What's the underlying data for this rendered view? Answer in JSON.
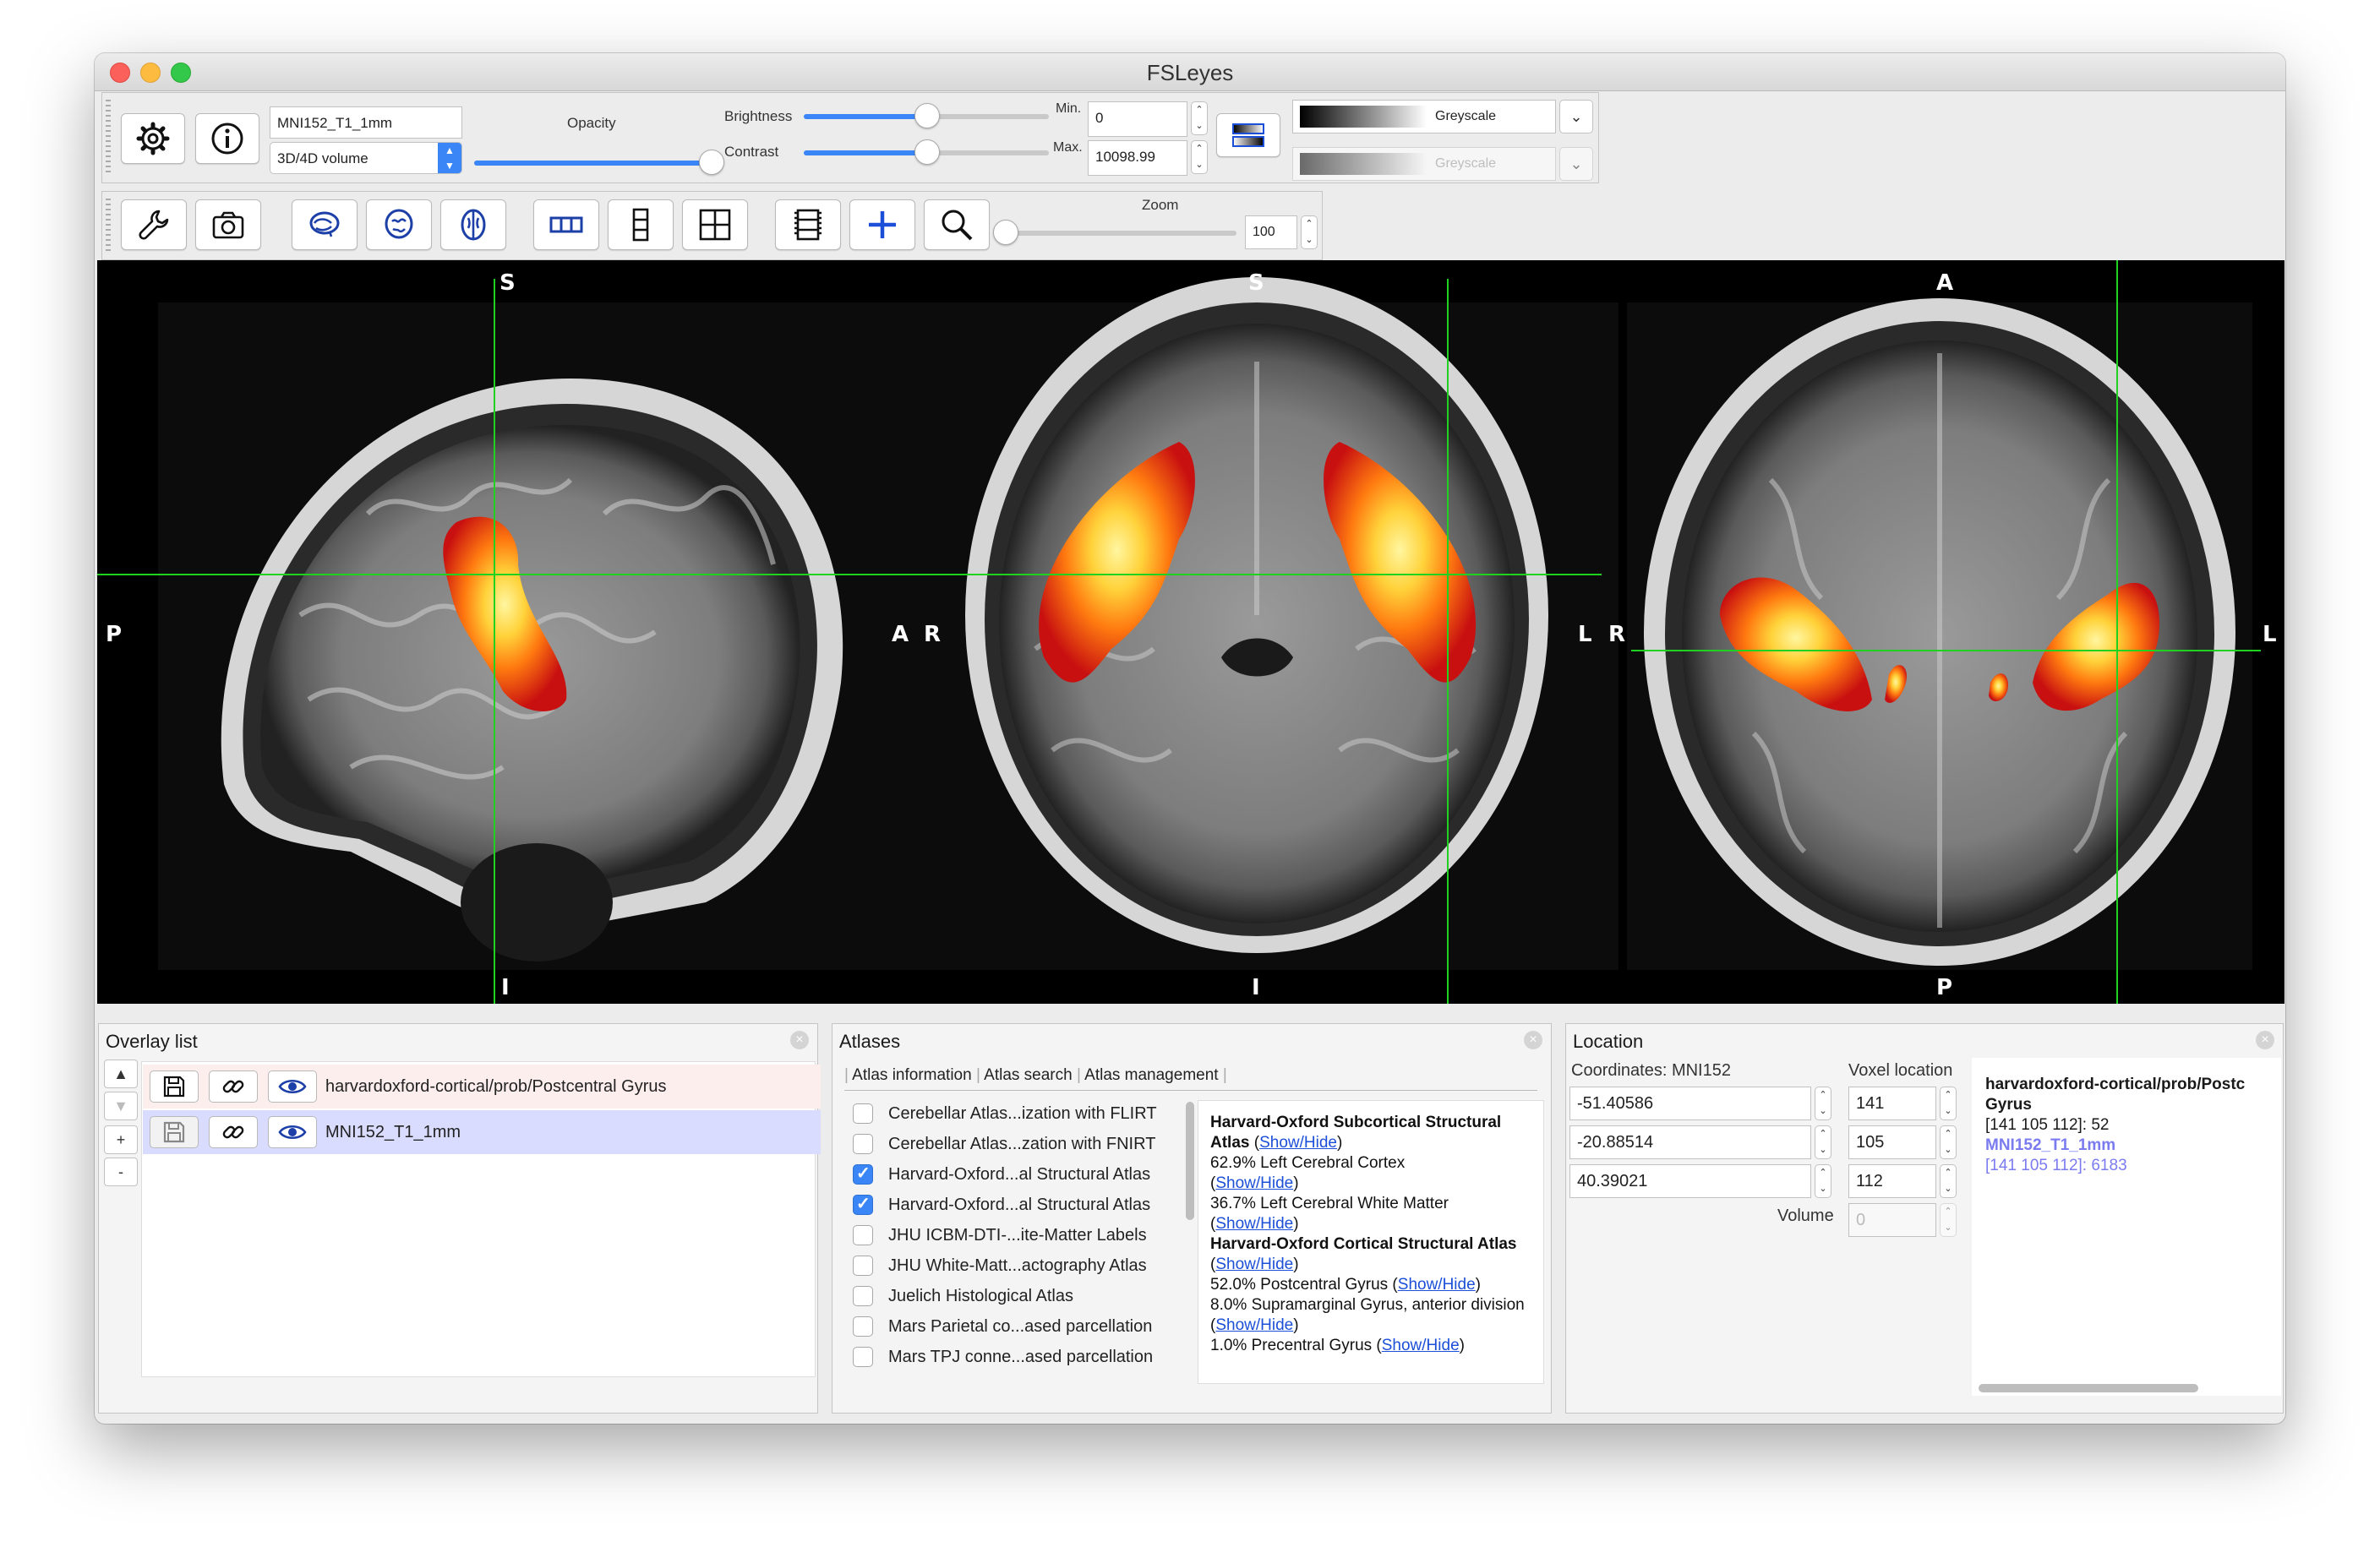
{
  "window": {
    "title": "FSLeyes"
  },
  "toolbar": {
    "image_name": "MNI152_T1_1mm",
    "image_type": "3D/4D volume",
    "opacity_label": "Opacity",
    "brightness_label": "Brightness",
    "contrast_label": "Contrast",
    "min_label": "Min.",
    "max_label": "Max.",
    "min_value": "0",
    "max_value": "10098.99",
    "cmap1": "Greyscale",
    "cmap2": "Greyscale",
    "zoom_label": "Zoom",
    "zoom_value": "100",
    "opacity_level": 1.0,
    "brightness_level": 0.5,
    "contrast_level": 0.5,
    "zoom_level": 0.0
  },
  "views": {
    "sagittal": {
      "top": "S",
      "bottom": "I",
      "left": "P",
      "right": "A"
    },
    "coronal": {
      "top": "S",
      "bottom": "I",
      "left": "R",
      "right": "L"
    },
    "axial": {
      "top": "A",
      "bottom": "P",
      "left": "R",
      "right": "L"
    },
    "cursor_color": "#1fd21f"
  },
  "overlay_list": {
    "title": "Overlay list",
    "items": [
      {
        "name": "harvardoxford-cortical/prob/Postcentral Gyrus",
        "selected": false
      },
      {
        "name": "MNI152_T1_1mm",
        "selected": true
      }
    ],
    "buttons": {
      "up": "▲",
      "down": "▼",
      "add": "+",
      "remove": "-"
    }
  },
  "atlases": {
    "title": "Atlases",
    "tabs": [
      "Atlas information",
      "Atlas search",
      "Atlas management"
    ],
    "list": [
      {
        "name": "Cerebellar Atlas...ization with FLIRT",
        "checked": false
      },
      {
        "name": "Cerebellar Atlas...zation with FNIRT",
        "checked": false
      },
      {
        "name": "Harvard-Oxford...al Structural Atlas",
        "checked": true
      },
      {
        "name": "Harvard-Oxford...al Structural Atlas",
        "checked": true
      },
      {
        "name": "JHU ICBM-DTI-...ite-Matter Labels",
        "checked": false
      },
      {
        "name": "JHU White-Matt...actography Atlas",
        "checked": false
      },
      {
        "name": "Juelich Histological Atlas",
        "checked": false
      },
      {
        "name": "Mars Parietal co...ased parcellation",
        "checked": false
      },
      {
        "name": "Mars TPJ conne...ased parcellation",
        "checked": false
      }
    ],
    "info": {
      "subcortical_title": "Harvard-Oxford Subcortical Structural Atlas",
      "sub_1": "62.9% Left Cerebral Cortex",
      "sub_2": "36.7% Left Cerebral White Matter",
      "cortical_title": "Harvard-Oxford Cortical Structural Atlas",
      "cort_1": "52.0% Postcentral Gyrus",
      "cort_2": "8.0% Supramarginal Gyrus, anterior division",
      "cort_3": "1.0% Precentral Gyrus",
      "show_hide": "Show/Hide"
    }
  },
  "location": {
    "title": "Location",
    "coords_label": "Coordinates: MNI152",
    "voxel_label": "Voxel location",
    "coords": [
      "-51.40586",
      "-20.88514",
      "40.39021"
    ],
    "voxels": [
      "141",
      "105",
      "112"
    ],
    "volume_label": "Volume",
    "volume_value": "0",
    "info_name": "harvardoxford-cortical/prob/Postcentral Gyrus",
    "info_name_visible": "harvardoxford-cortical/prob/Postc",
    "info_name_line2": "Gyrus",
    "info_val1": "[141 105 112]: 52",
    "info_name2": "MNI152_T1_1mm",
    "info_val2": "[141 105 112]: 6183"
  }
}
